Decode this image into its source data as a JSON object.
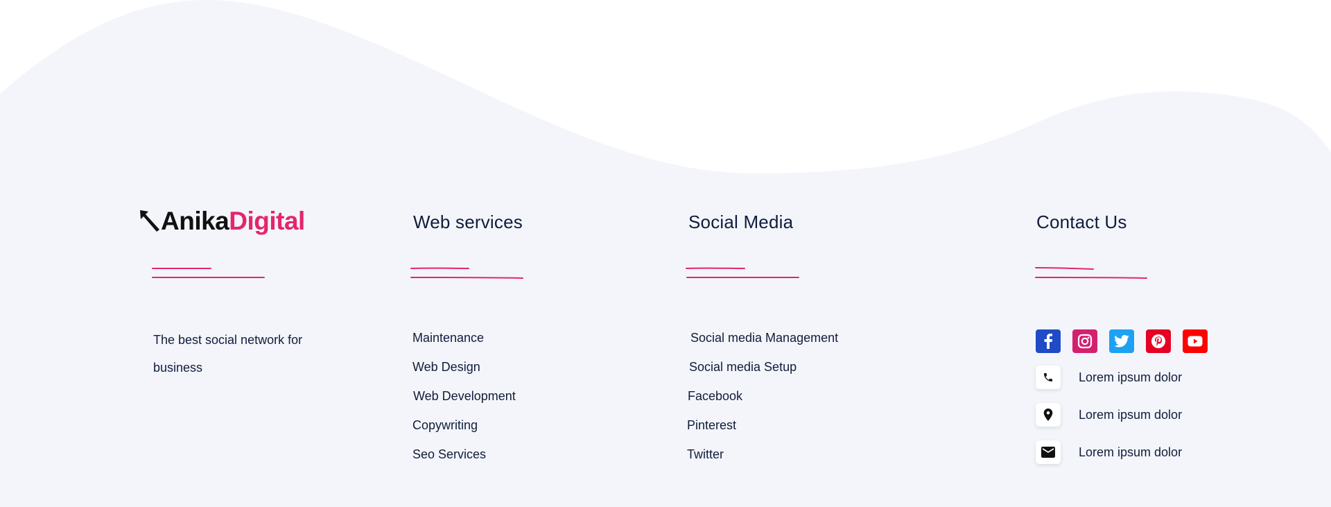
{
  "brand": {
    "name_part1": "Anika",
    "name_part2": "Digital",
    "tagline": "The best social network for business"
  },
  "web_services": {
    "heading": "Web services",
    "links": [
      "Maintenance",
      "Web Design",
      "Web Development",
      "Copywriting",
      "Seo Services"
    ]
  },
  "social_media": {
    "heading": "Social Media",
    "links": [
      "Social media Management",
      "Social media Setup",
      "Facebook",
      "Pinterest",
      "Twitter"
    ]
  },
  "contact": {
    "heading": "Contact Us",
    "social_icons": [
      "facebook-icon",
      "instagram-icon",
      "twitter-icon",
      "pinterest-icon",
      "youtube-icon"
    ],
    "items": [
      {
        "icon": "phone-icon",
        "text": "Lorem ipsum dolor"
      },
      {
        "icon": "location-pin-icon",
        "text": "Lorem ipsum dolor"
      },
      {
        "icon": "email-icon",
        "text": "Lorem ipsum dolor"
      }
    ]
  },
  "colors": {
    "background": "#f4f5fb",
    "accent": "#e6246e",
    "text": "#0f1d3a",
    "facebook": "#1f4bc6",
    "instagram": "#d4206f",
    "twitter": "#1da1f2",
    "pinterest": "#e60023",
    "youtube": "#ff0000"
  }
}
